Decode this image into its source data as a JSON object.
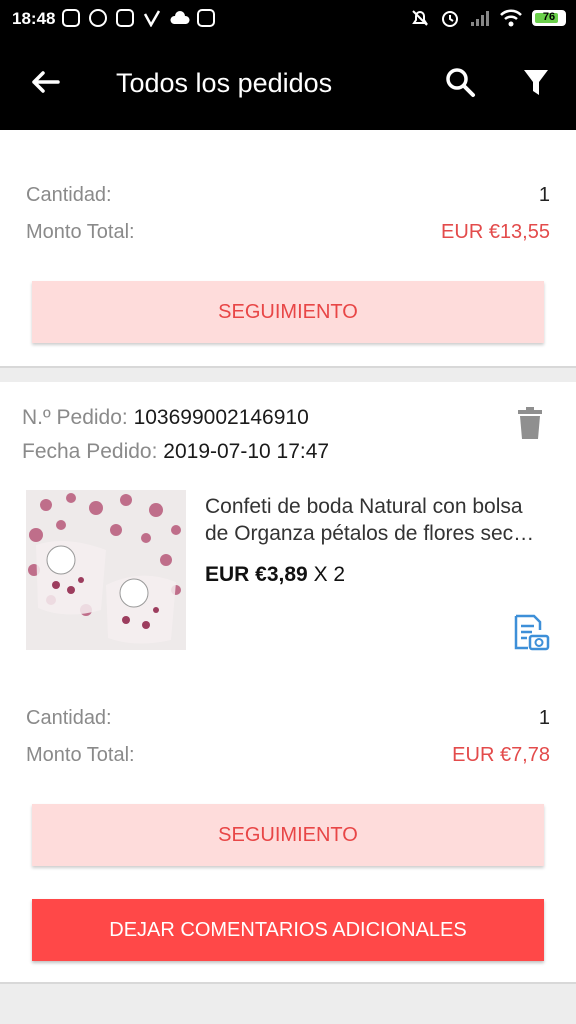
{
  "status_bar": {
    "time": "18:48",
    "battery": "76"
  },
  "app_bar": {
    "title": "Todos los pedidos"
  },
  "orders": [
    {
      "quantity_label": "Cantidad:",
      "quantity": "1",
      "total_label": "Monto Total:",
      "total": "EUR €13,55",
      "track_button": "SEGUIMIENTO"
    },
    {
      "order_no_label": "N.º Pedido:",
      "order_no": "103699002146910",
      "date_label": "Fecha Pedido:",
      "date": "2019-07-10 17:47",
      "product": {
        "name": "Confeti de boda Natural con bolsa de Organza pétalos de flores sec…",
        "price": "EUR €3,89",
        "qty": " X 2"
      },
      "quantity_label": "Cantidad:",
      "quantity": "1",
      "total_label": "Monto Total:",
      "total": "EUR €7,78",
      "track_button": "SEGUIMIENTO",
      "feedback_button": "DEJAR COMENTARIOS ADICIONALES"
    }
  ],
  "colors": {
    "accent": "#ff4848",
    "price_red": "#e34b4b",
    "track_bg": "#fedcdb",
    "icon_blue": "#3d8fd8"
  }
}
